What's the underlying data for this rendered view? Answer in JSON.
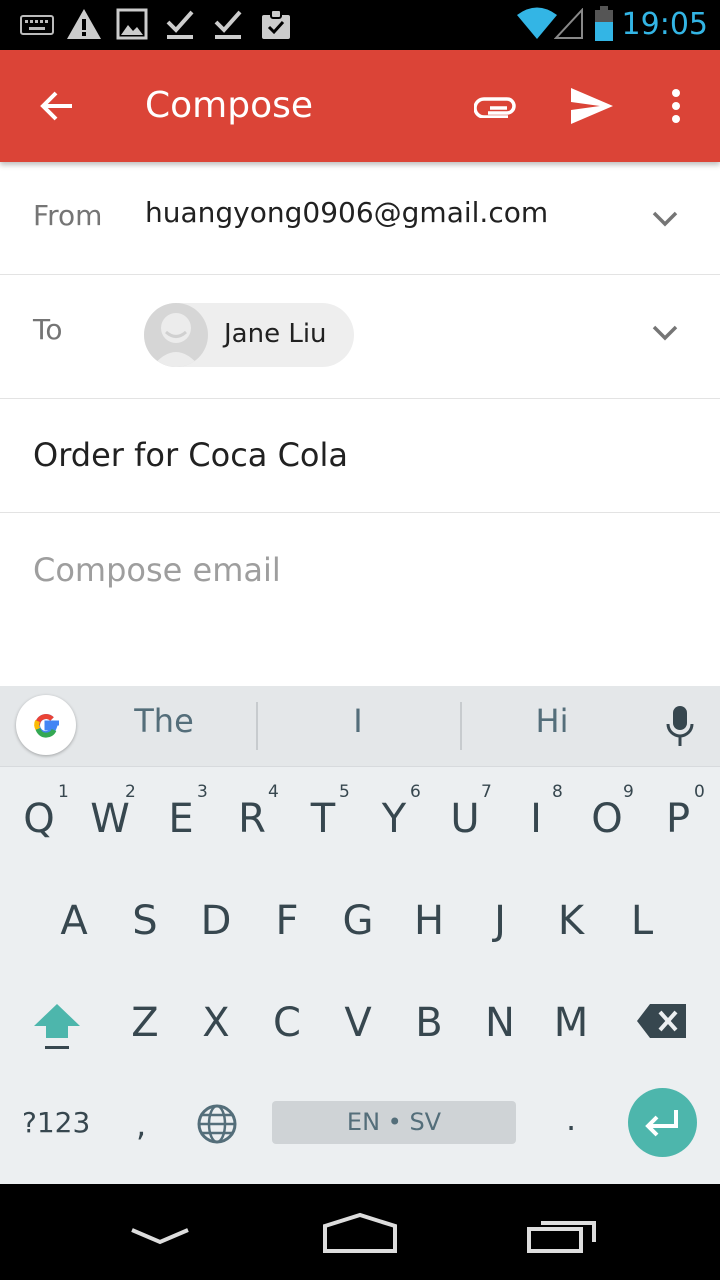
{
  "status_bar": {
    "time": "19:05",
    "icons": [
      "keyboard-icon",
      "warning-icon",
      "image-icon",
      "download-done-icon",
      "download-done-icon",
      "clipboard-check-icon",
      "wifi-icon",
      "signal-icon",
      "battery-icon"
    ]
  },
  "app_bar": {
    "title": "Compose",
    "actions": [
      "back-arrow-icon",
      "attach-icon",
      "send-icon",
      "more-vert-icon"
    ],
    "color": "#db4437"
  },
  "compose": {
    "from_label": "From",
    "from_value": "huangyong0906@gmail.com",
    "to_label": "To",
    "to_recipient": "Jane Liu",
    "subject": "Order for Coca Cola",
    "body_placeholder": "Compose email"
  },
  "keyboard": {
    "suggestions": [
      "The",
      "I",
      "Hi"
    ],
    "row1": [
      "Q",
      "W",
      "E",
      "R",
      "T",
      "Y",
      "U",
      "I",
      "O",
      "P"
    ],
    "row1_hints": [
      "1",
      "2",
      "3",
      "4",
      "5",
      "6",
      "7",
      "8",
      "9",
      "0"
    ],
    "row2": [
      "A",
      "S",
      "D",
      "F",
      "G",
      "H",
      "J",
      "K",
      "L"
    ],
    "row3": [
      "Z",
      "X",
      "C",
      "V",
      "B",
      "N",
      "M"
    ],
    "symbols_label": "?123",
    "comma": ",",
    "period": ".",
    "space_label": "EN • SV",
    "accent": "#4db6ac"
  },
  "nav_bar": {
    "buttons": [
      "back-icon",
      "home-icon",
      "recents-icon"
    ]
  }
}
